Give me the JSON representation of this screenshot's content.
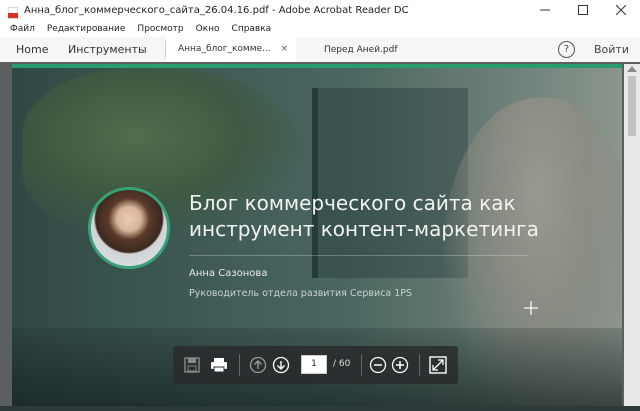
{
  "window": {
    "title": "Анна_блог_коммерческого_сайта_26.04.16.pdf - Adobe Acrobat Reader DC",
    "controls": {
      "minimize": "—",
      "maximize": "☐",
      "close": "✕"
    }
  },
  "menu": {
    "items": [
      "Файл",
      "Редактирование",
      "Просмотр",
      "Окно",
      "Справка"
    ]
  },
  "nav": {
    "home": "Home",
    "tools": "Инструменты",
    "help": "?",
    "signin": "Войти"
  },
  "tabs": [
    {
      "label": "Анна_блог_комме...",
      "close": "×",
      "active": true
    },
    {
      "label": "Перед Аней.pdf",
      "active": false
    }
  ],
  "slide": {
    "headline_line1": "Блог коммерческого сайта как",
    "headline_line2": "инструмент контент-маркетинга",
    "author": "Анна Сазонова",
    "role": "Руководитель отдела развития Сервиса 1PS"
  },
  "toolbar": {
    "current_page": "1",
    "total_pages": "/ 60"
  },
  "colors": {
    "accent": "#2a9d6e",
    "toolbar_bg": "#2b2d2f"
  },
  "icons": {
    "save": "save-icon",
    "print": "print-icon",
    "prev": "arrow-up-circle-icon",
    "next": "arrow-down-circle-icon",
    "zoom_out": "minus-circle-icon",
    "zoom_in": "plus-circle-icon",
    "fit": "fit-page-icon"
  }
}
